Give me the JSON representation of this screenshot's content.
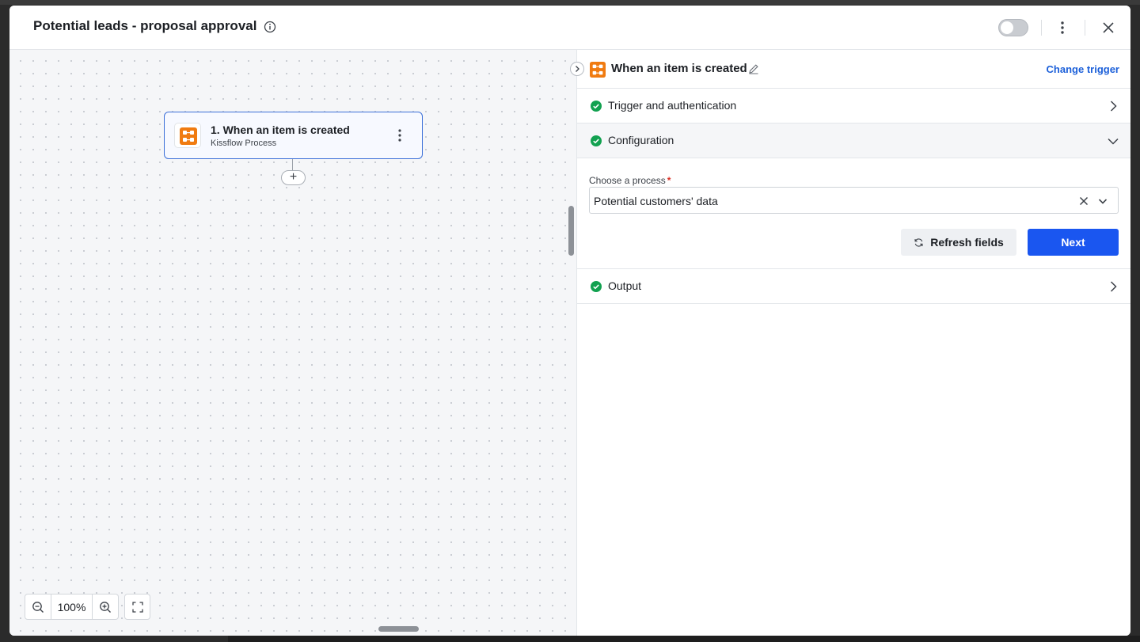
{
  "header": {
    "title": "Potential leads - proposal approval",
    "toggle_on": false
  },
  "canvas": {
    "node": {
      "title": "1. When an item is created",
      "subtitle": "Kissflow Process"
    },
    "add_step": "+",
    "zoom": "100%"
  },
  "panel": {
    "title": "When an item is created",
    "change_trigger": "Change trigger",
    "sections": {
      "trigger": "Trigger and authentication",
      "configuration": "Configuration",
      "output": "Output"
    },
    "process_field": {
      "label": "Choose a process",
      "required_mark": "*",
      "value": "Potential customers' data"
    },
    "refresh_label": "Refresh fields",
    "next_label": "Next"
  },
  "colors": {
    "accent": "#1a56f0",
    "brand_orange": "#f07b10",
    "success": "#12a150",
    "link": "#1b5fd9"
  },
  "icons": [
    "info-icon",
    "kebab-icon",
    "close-icon",
    "zoom-out-icon",
    "zoom-in-icon",
    "fit-screen-icon",
    "chevron-right-icon",
    "chevron-down-icon",
    "check-circle-icon",
    "pencil-icon",
    "refresh-icon",
    "kissflow-logo"
  ]
}
